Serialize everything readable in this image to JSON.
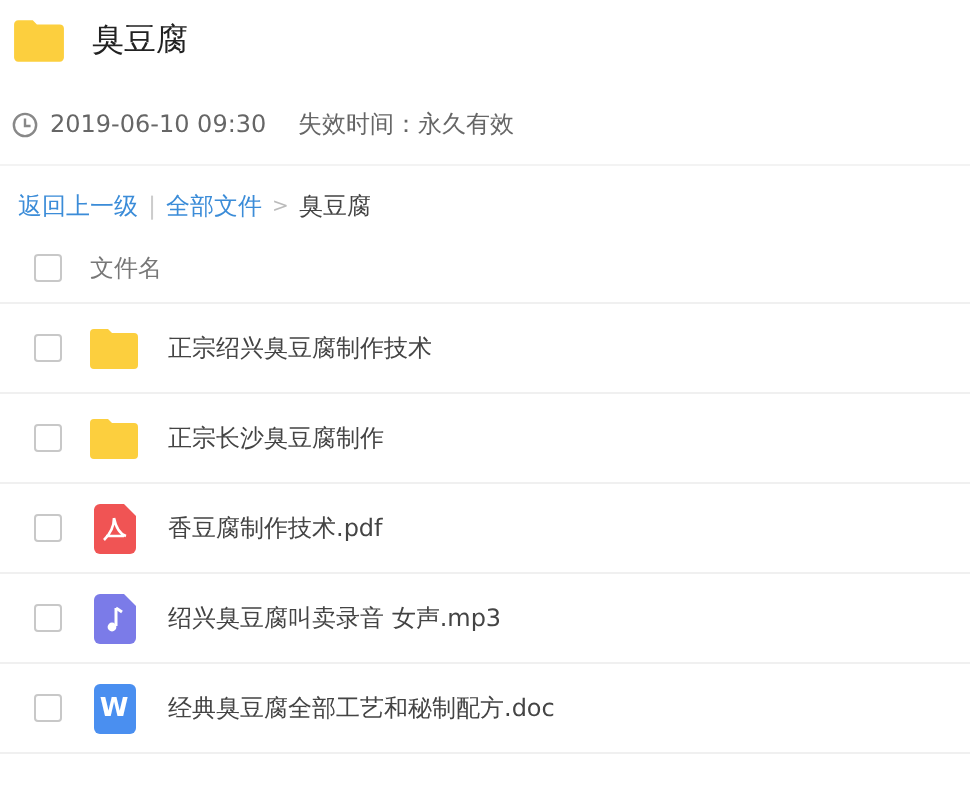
{
  "header": {
    "title": "臭豆腐",
    "time": "2019-06-10 09:30",
    "expiry": "失效时间：永久有效"
  },
  "breadcrumb": {
    "links": [
      "返回上一级",
      "全部文件"
    ],
    "separator": "|",
    "arrow": ">",
    "current": "臭豆腐"
  },
  "table": {
    "header": {
      "label": "文件名",
      "checked": false
    },
    "rows": [
      {
        "kind": "folder",
        "name": "正宗绍兴臭豆腐制作技术",
        "checked": false
      },
      {
        "kind": "folder",
        "name": "正宗长沙臭豆腐制作",
        "checked": false
      },
      {
        "kind": "pdf",
        "name": "香豆腐制作技术.pdf",
        "checked": false
      },
      {
        "kind": "audio",
        "name": "绍兴臭豆腐叫卖录音 女声.mp3",
        "checked": false
      },
      {
        "kind": "doc",
        "name": "经典臭豆腐全部工艺和秘制配方.doc",
        "checked": false,
        "glyph": "W"
      }
    ]
  }
}
